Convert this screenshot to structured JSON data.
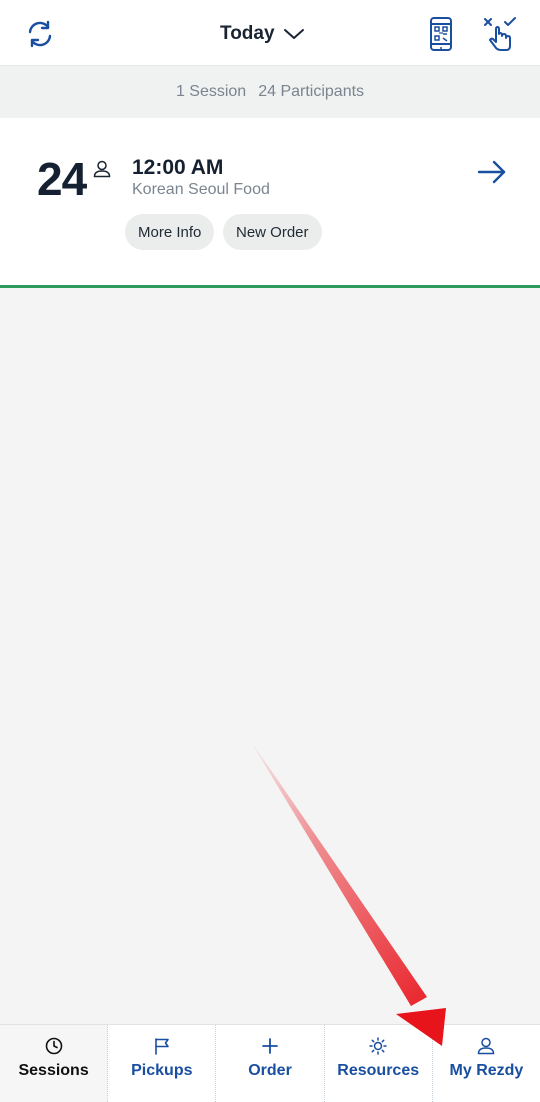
{
  "header": {
    "refresh_icon": "refresh-icon",
    "date_label": "Today",
    "date_chevron_icon": "chevron-down-icon",
    "scanner_icon": "phone-barcode-icon",
    "checkin_icon": "tap-checkin-icon"
  },
  "summary": {
    "sessions": "1 Session",
    "participants": "24 Participants"
  },
  "session": {
    "count": "24",
    "participants_icon": "person-icon",
    "time": "12:00 AM",
    "product": "Korean Seoul Food",
    "more_info_label": "More Info",
    "new_order_label": "New Order",
    "open_icon": "arrow-right-icon"
  },
  "tabs": [
    {
      "label": "Sessions",
      "icon": "clock-icon",
      "active": true
    },
    {
      "label": "Pickups",
      "icon": "flag-icon",
      "active": false
    },
    {
      "label": "Order",
      "icon": "plus-icon",
      "active": false
    },
    {
      "label": "Resources",
      "icon": "sun-icon",
      "active": false
    },
    {
      "label": "My Rezdy",
      "icon": "person-icon",
      "active": false
    }
  ],
  "colors": {
    "accent_blue": "#1a4fa0",
    "divider_green": "#2e9b5c",
    "annotation_red": "#e8141c"
  }
}
